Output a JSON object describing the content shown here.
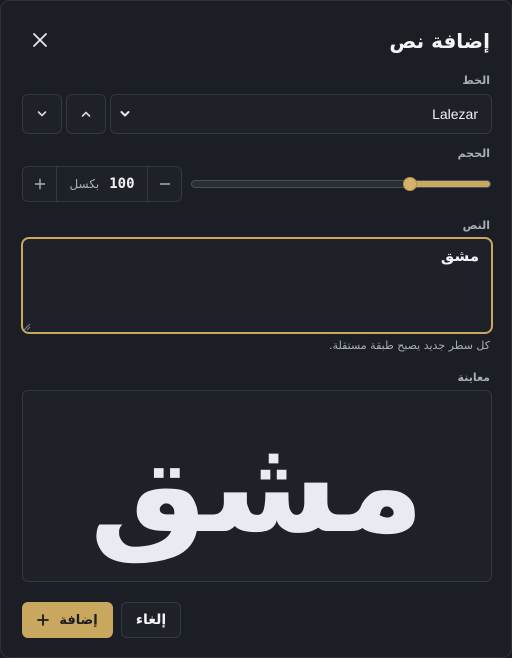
{
  "dialog": {
    "title": "إضافة نص",
    "close_icon": "close-icon"
  },
  "font": {
    "label": "الخط",
    "selected": "Lalezar",
    "prev_icon": "chevron-up-icon",
    "next_icon": "chevron-down-icon"
  },
  "size": {
    "label": "الحجم",
    "value": "100",
    "unit": "بكسل",
    "slider_fraction": 0.73,
    "decrement_icon": "minus-icon",
    "increment_icon": "plus-icon"
  },
  "text": {
    "label": "النص",
    "value": "مشق",
    "hint": "كل سطر جديد يصبح طبقة مستقلة."
  },
  "preview": {
    "label": "معاينة",
    "text": "مشق"
  },
  "actions": {
    "cancel_label": "إلغاء",
    "add_label": "إضافة",
    "add_icon": "plus-icon"
  },
  "colors": {
    "accent": "#c9a75e",
    "background": "#1c1e25",
    "surface": "#1f2129",
    "border": "#343842"
  }
}
